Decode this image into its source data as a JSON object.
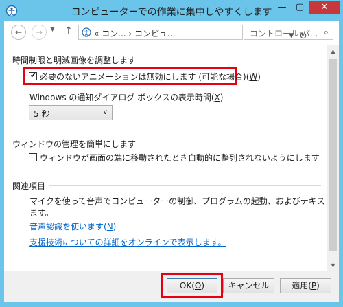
{
  "window": {
    "title": "コンピューターでの作業に集中しやすくします"
  },
  "controls": {
    "minimize": "—",
    "maximize": "▢",
    "close": "✕"
  },
  "nav": {
    "back_icon": "arrow-left-icon",
    "forward_icon": "arrow-right-icon",
    "up_icon": "arrow-up-icon",
    "address_text": "«  コン...  ›  コンピュ...",
    "search_placeholder": "コントロール パ..."
  },
  "sections": {
    "time_limits": {
      "title": "時間制限と明滅画像を調整します",
      "disable_animations": {
        "label": "必要のないアニメーションは無効にします (可能な場合)(",
        "key": "W",
        "end": ")",
        "checked": true
      },
      "notification_label": {
        "text": "Windows の通知ダイアログ ボックスの表示時間(",
        "key": "X",
        "end": ")"
      },
      "notification_duration": "5 秒"
    },
    "window_management": {
      "title": "ウィンドウの管理を簡単にします",
      "prevent_arrange": {
        "label": "ウィンドウが画面の端に移動されたとき自動的に整列されないようにします",
        "checked": false
      }
    },
    "related": {
      "title": "関連項目",
      "description_line1": "マイクを使って音声でコンピューターの制御、プログラムの起動、およびテキストの入力を行い",
      "description_line2": "ます。",
      "speech_link": {
        "text": "音声認識を使います(",
        "key": "N",
        "end": ")"
      },
      "assistive_link": "支援技術についての詳細をオンラインで表示します。"
    }
  },
  "buttons": {
    "ok": {
      "text": "OK(",
      "key": "O",
      "end": ")"
    },
    "cancel": "キャンセル",
    "apply": {
      "text": "適用(",
      "key": "P",
      "end": ")"
    }
  },
  "colors": {
    "titlebar": "#6bc4ea",
    "highlight": "#e60012",
    "link": "#0066cc",
    "close": "#c7383a"
  }
}
